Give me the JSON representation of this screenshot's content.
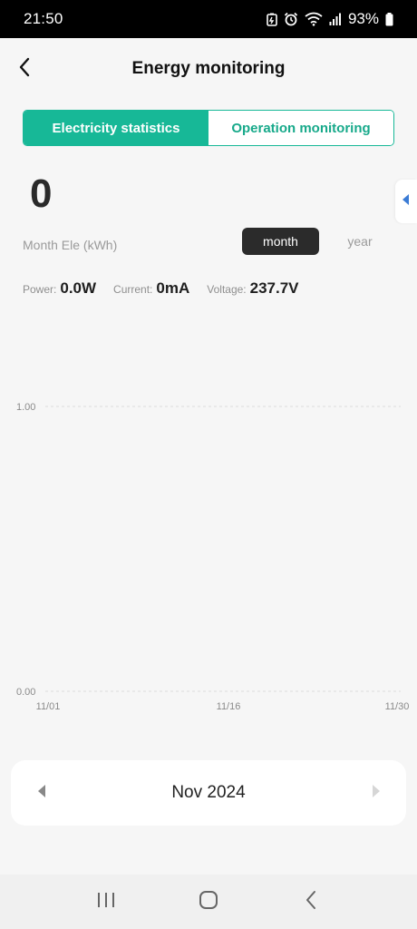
{
  "status_bar": {
    "time": "21:50",
    "battery_percent": "93%",
    "icons": [
      "battery-saver-icon",
      "alarm-icon",
      "wifi-icon",
      "signal-icon",
      "battery-icon"
    ]
  },
  "header": {
    "title": "Energy monitoring",
    "back_icon": "chevron-left-icon"
  },
  "tabs": [
    {
      "label": "Electricity statistics",
      "active": true
    },
    {
      "label": "Operation monitoring",
      "active": false
    }
  ],
  "summary": {
    "value": "0",
    "label": "Month Ele (kWh)",
    "period_options": [
      "month",
      "year"
    ],
    "selected_period": "month"
  },
  "metrics": [
    {
      "label": "Power:",
      "value": "0.0W"
    },
    {
      "label": "Current:",
      "value": "0mA"
    },
    {
      "label": "Voltage:",
      "value": "237.7V"
    }
  ],
  "chart_data": {
    "type": "line",
    "x": [
      "11/01",
      "11/16",
      "11/30"
    ],
    "y_ticks": [
      "1.00",
      "0.00"
    ],
    "ylim": [
      0,
      1
    ],
    "series": [],
    "grid": true
  },
  "date_selector": {
    "label": "Nov 2024"
  },
  "colors": {
    "accent": "#17b897",
    "dark_button": "#2b2b2b",
    "background": "#f6f6f6"
  }
}
